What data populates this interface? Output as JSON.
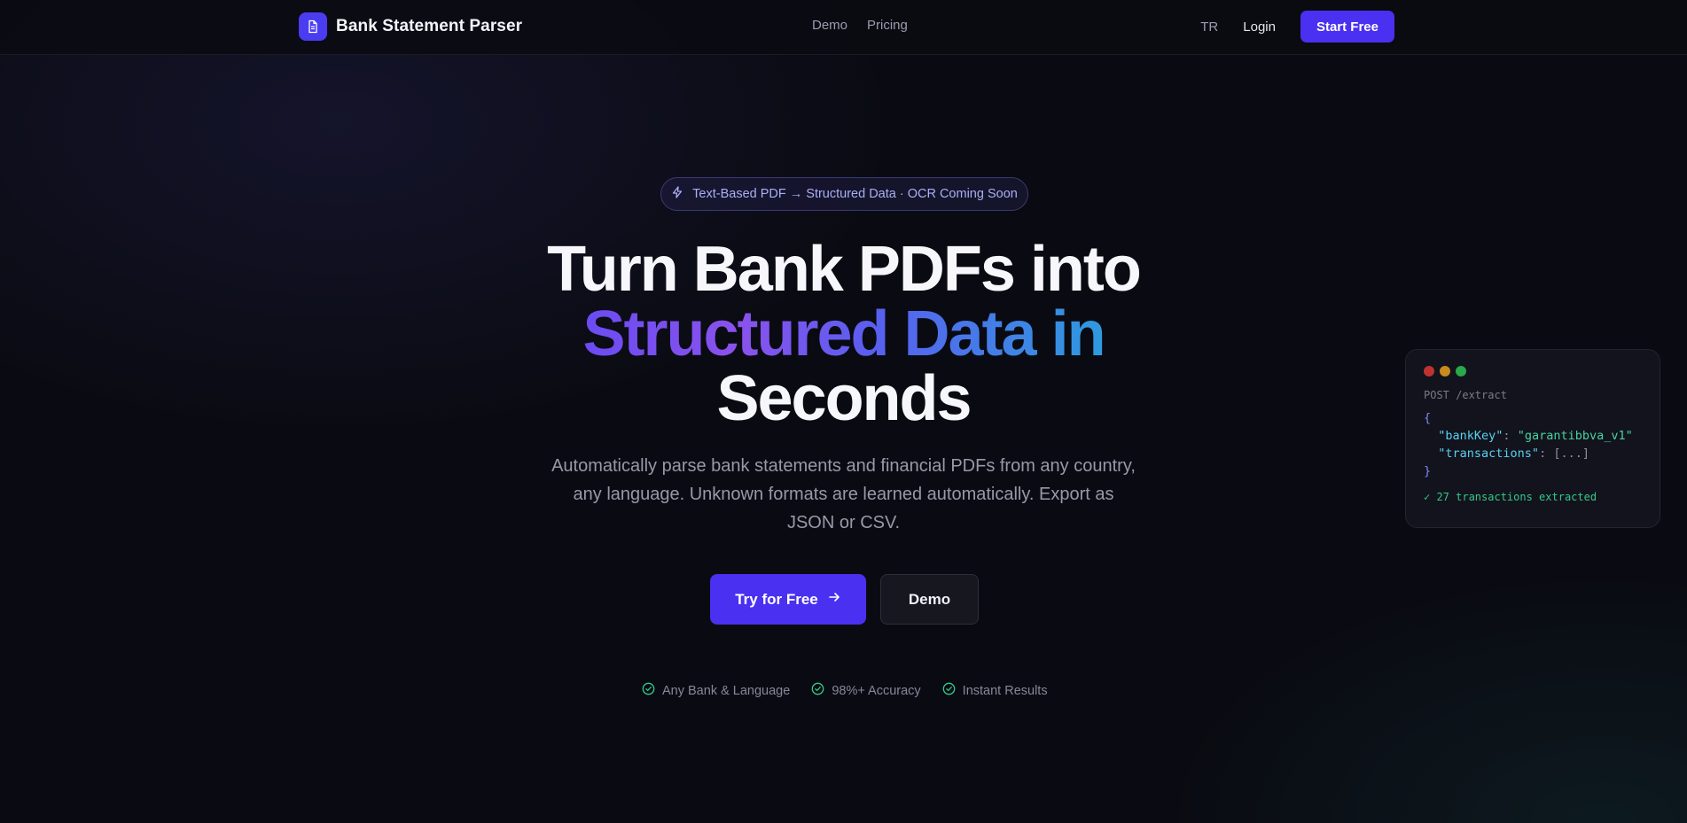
{
  "header": {
    "brand_name": "Bank Statement Parser",
    "nav": [
      "Demo",
      "Pricing"
    ],
    "lang": "TR",
    "login": "Login",
    "start_button": "Start Free"
  },
  "hero": {
    "badge": "Text-Based PDF → Structured Data · OCR Coming Soon",
    "headline_line1": "Turn Bank PDFs into",
    "headline_line2": "Structured Data in",
    "headline_line3": "Seconds",
    "subtitle": "Automatically parse bank statements and financial PDFs from any country, any language. Unknown formats are learned automatically. Export as JSON or CSV.",
    "cta_primary": "Try for Free",
    "cta_secondary": "Demo",
    "features": [
      "Any Bank & Language",
      "98%+ Accuracy",
      "Instant Results"
    ]
  },
  "code_card": {
    "title": "POST /extract",
    "open_brace": "{",
    "key1": "\"bankKey\"",
    "val1": "\"garantibbva_v1\"",
    "key2": "\"transactions\"",
    "val2": "[...]",
    "close_brace": "}",
    "result": "✓ 27 transactions extracted",
    "dot_colors": [
      "#c0322f",
      "#c98a1e",
      "#2aa84a"
    ]
  },
  "colors": {
    "accent": "#4a30f0",
    "success": "#35c98b",
    "background": "#0a0b12"
  },
  "icons": {
    "brand": "document-icon",
    "badge": "lightning-icon",
    "cta": "arrow-right-icon",
    "feature": "check-circle-icon"
  }
}
